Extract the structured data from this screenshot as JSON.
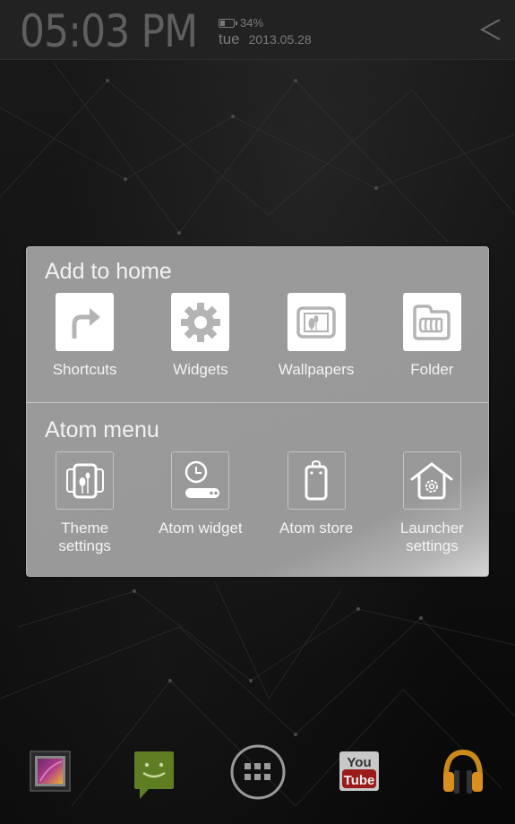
{
  "status_bar": {
    "time": "05:03",
    "ampm": "PM",
    "battery_percent": "34%",
    "day": "tue",
    "date": "2013.05.28",
    "back_icon": "chevron-left-icon"
  },
  "menu": {
    "sections": [
      {
        "title": "Add to home",
        "items": [
          {
            "label": "Shortcuts",
            "icon": "shortcut-arrow-icon"
          },
          {
            "label": "Widgets",
            "icon": "gear-icon"
          },
          {
            "label": "Wallpapers",
            "icon": "wallpaper-icon"
          },
          {
            "label": "Folder",
            "icon": "folder-icon"
          }
        ]
      },
      {
        "title": "Atom menu",
        "items": [
          {
            "label": "Theme\nsettings",
            "icon": "theme-icon"
          },
          {
            "label": "Atom widget",
            "icon": "clock-widget-icon"
          },
          {
            "label": "Atom store",
            "icon": "shopping-bag-icon"
          },
          {
            "label": "Launcher\nsettings",
            "icon": "house-gear-icon"
          }
        ]
      }
    ]
  },
  "dock": {
    "items": [
      {
        "name": "gallery",
        "icon": "gallery-icon"
      },
      {
        "name": "messaging",
        "icon": "messaging-icon"
      },
      {
        "name": "app-drawer",
        "icon": "app-drawer-icon"
      },
      {
        "name": "youtube",
        "icon": "youtube-icon",
        "text_top": "You",
        "text_bottom": "Tube"
      },
      {
        "name": "play-music",
        "icon": "headphones-icon"
      }
    ]
  },
  "colors": {
    "panel": "#9a9a9a",
    "tile_icon": "#b4b4b4",
    "messaging_green": "#6b8e23",
    "youtube_red": "#b22222",
    "music_orange": "#e69a1e"
  }
}
